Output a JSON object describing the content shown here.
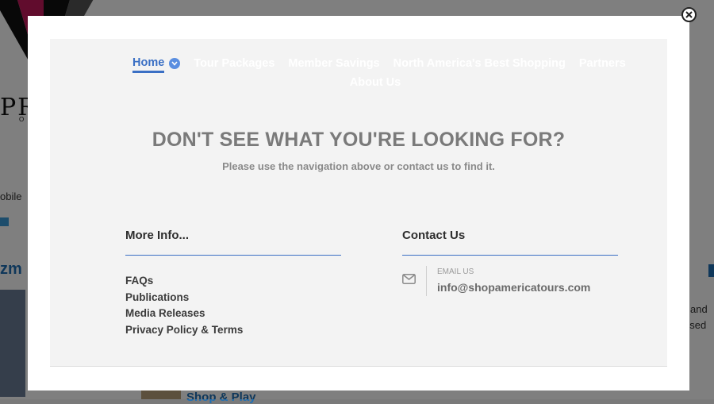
{
  "background": {
    "logo_text": "PR",
    "logo_sub": "O",
    "left_text": "obile",
    "left_heading": "zm",
    "right_text_a": "and",
    "right_text_b": "osed",
    "bottom_link": "Shop & Play"
  },
  "modal": {
    "nav": {
      "items": [
        "Home",
        "Tour Packages",
        "Member Savings",
        "North America's Best Shopping",
        "Partners",
        "About Us"
      ],
      "active": "Home"
    },
    "heading": "DON'T SEE WHAT YOU'RE LOOKING FOR?",
    "subheading": "Please use the navigation above or contact us to find it.",
    "more_info": {
      "title": "More Info...",
      "links": [
        "FAQs",
        "Publications",
        "Media Releases",
        "Privacy Policy & Terms"
      ]
    },
    "contact": {
      "title": "Contact Us",
      "label": "EMAIL US",
      "email": "info@shopamericatours.com"
    }
  },
  "colors": {
    "accent": "#3a6fc4",
    "panel": "#f3f3f3"
  },
  "icons": {
    "close": "close-icon",
    "email": "envelope-icon",
    "dropdown": "chevron-down-icon"
  }
}
